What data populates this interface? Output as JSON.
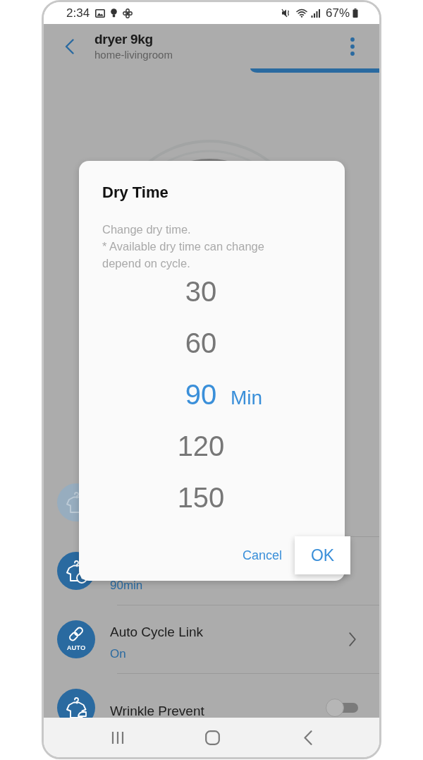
{
  "status_bar": {
    "time": "2:34",
    "battery": "67%"
  },
  "header": {
    "title": "dryer 9kg",
    "subtitle": "home-livingroom"
  },
  "settings": [
    {
      "kind": "plain",
      "disabled": true
    },
    {
      "kind": "plain",
      "disabled": false,
      "value": "90min"
    },
    {
      "kind": "link",
      "disabled": false,
      "icon_label": "AUTO",
      "title": "Auto Cycle Link",
      "value": "On"
    },
    {
      "kind": "toggle",
      "disabled": false,
      "title": "Wrinkle Prevent",
      "on": false
    }
  ],
  "dialog": {
    "title": "Dry Time",
    "description": [
      "Change dry time.",
      "* Available dry time can change depend on cycle."
    ],
    "picker": {
      "unit": "Min",
      "options": [
        {
          "value": "30",
          "selected": false
        },
        {
          "value": "60",
          "selected": false
        },
        {
          "value": "90",
          "selected": true
        },
        {
          "value": "120",
          "selected": false
        },
        {
          "value": "150",
          "selected": false
        }
      ]
    },
    "buttons": [
      {
        "label": "Cancel",
        "focused": false
      },
      {
        "label": "OK",
        "focused": true
      }
    ]
  }
}
